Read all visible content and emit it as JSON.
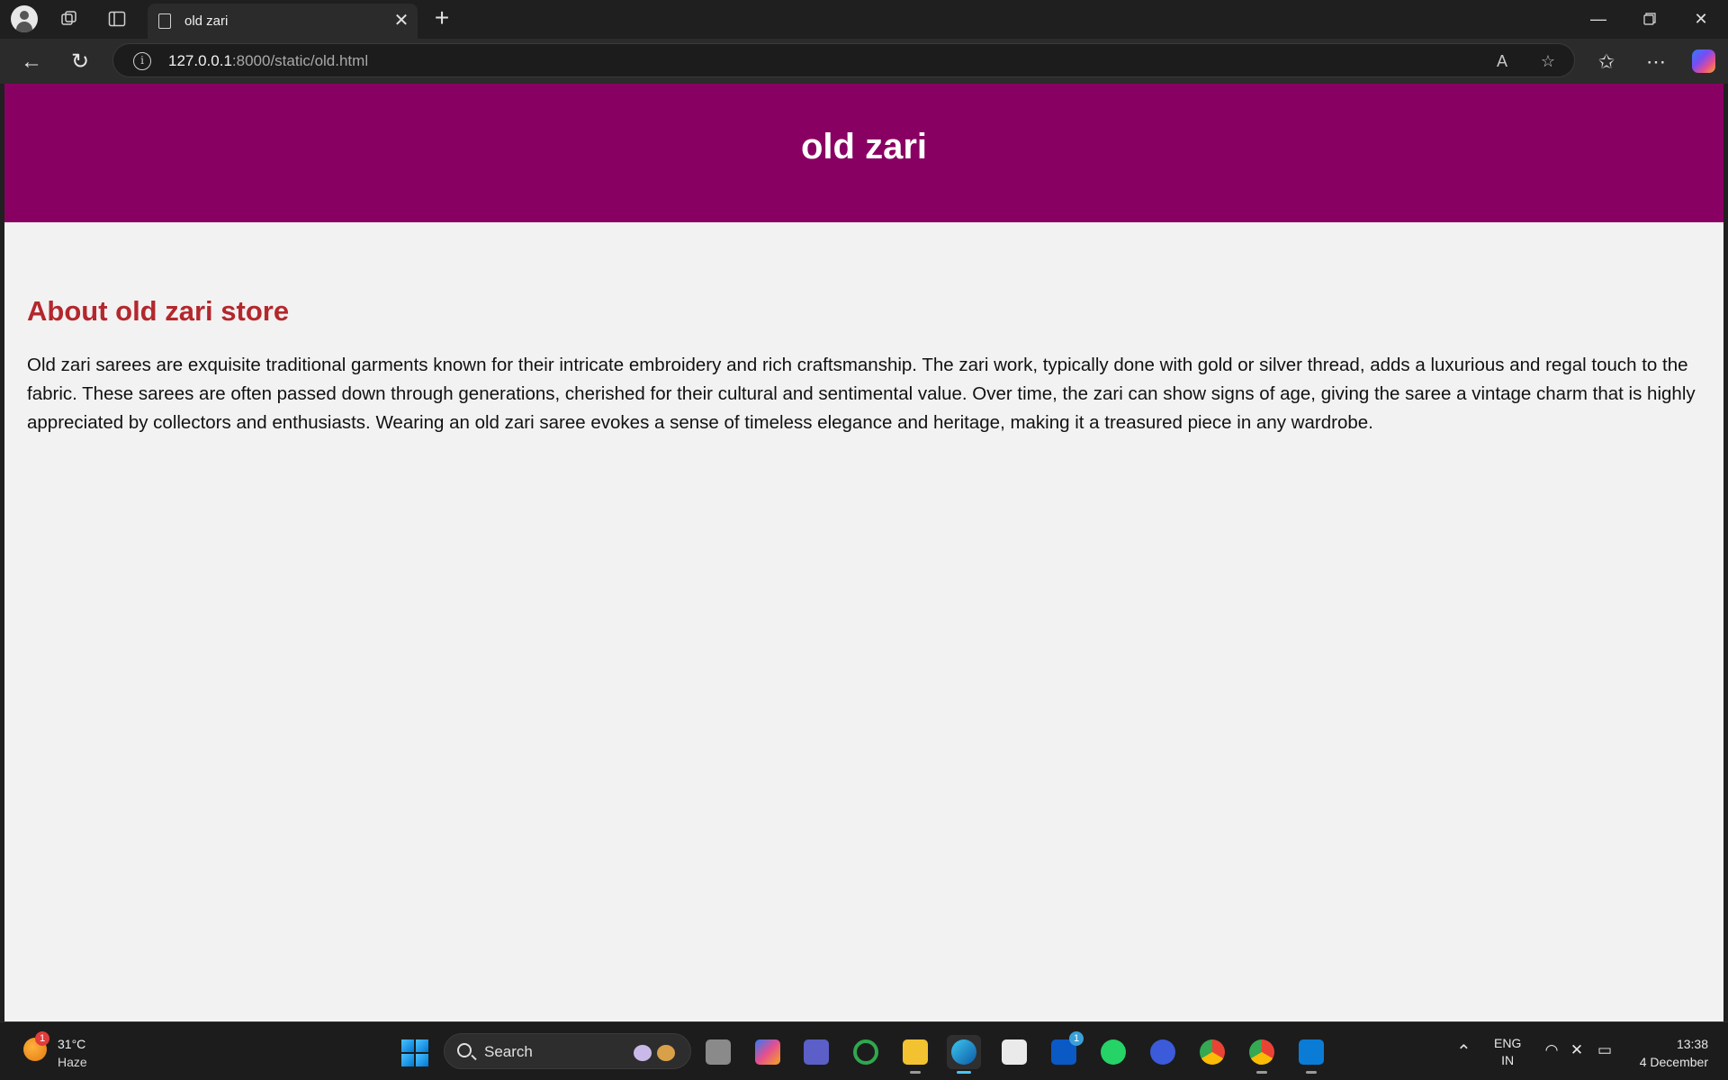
{
  "browser": {
    "tab_title": "old zari",
    "url_host": "127.0.0.1",
    "url_rest": ":8000/static/old.html"
  },
  "page": {
    "header_title": "old zari",
    "section_heading": "About old zari store",
    "paragraph": "Old zari sarees are exquisite traditional garments known for their intricate embroidery and rich craftsmanship. The zari work, typically done with gold or silver thread, adds a luxurious and regal touch to the fabric. These sarees are often passed down through generations, cherished for their cultural and sentimental value. Over time, the zari can show signs of age, giving the saree a vintage charm that is highly appreciated by collectors and enthusiasts. Wearing an old zari saree evokes a sense of timeless elegance and heritage, making it a treasured piece in any wardrobe."
  },
  "taskbar": {
    "weather_badge": "1",
    "weather_temp": "31°C",
    "weather_condition": "Haze",
    "search_label": "Search",
    "app_badge": "1",
    "lang_line1": "ENG",
    "lang_line2": "IN",
    "time": "13:38",
    "date": "4 December"
  },
  "colors": {
    "header_bg": "#880062",
    "heading": "#b3282d",
    "page_bg": "#f2f2f2"
  },
  "icons": [
    "profile-icon",
    "workspaces-icon",
    "vertical-tabs-icon",
    "page-icon",
    "close-icon",
    "plus-icon",
    "minimize-icon",
    "restore-icon",
    "back-icon",
    "refresh-icon",
    "info-icon",
    "read-aloud-icon",
    "favorite-star-icon",
    "favorites-icon",
    "more-icon",
    "copilot-icon",
    "windows-start-icon",
    "search-icon",
    "chevron-up-icon",
    "wifi-icon",
    "volume-muted-icon",
    "battery-icon"
  ]
}
